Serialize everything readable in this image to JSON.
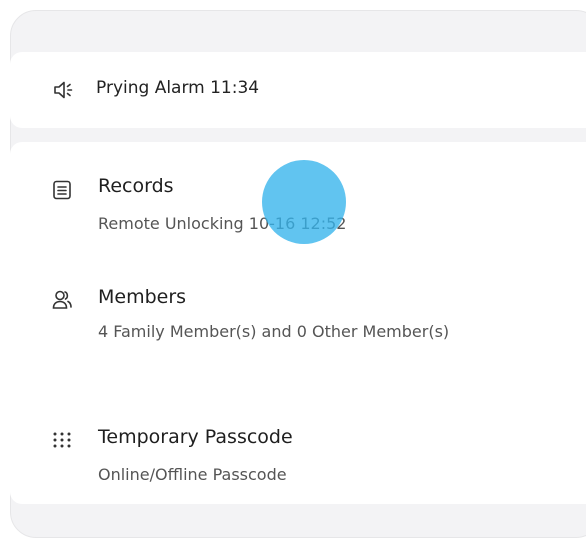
{
  "alarm": {
    "label": "Prying Alarm 11:34",
    "icon": "speaker-alert-icon"
  },
  "menu": {
    "items": [
      {
        "title": "Records",
        "subtitle": "Remote Unlocking 10-16 12:52",
        "icon": "document-list-icon"
      },
      {
        "title": "Members",
        "subtitle": "4 Family Member(s) and 0 Other Member(s)",
        "icon": "members-icon"
      },
      {
        "title": "Temporary Passcode",
        "subtitle": "Online/Offline Passcode",
        "icon": "keypad-icon"
      }
    ]
  },
  "colors": {
    "touch_indicator": "#35b3ec",
    "card_background": "#f3f3f5"
  }
}
